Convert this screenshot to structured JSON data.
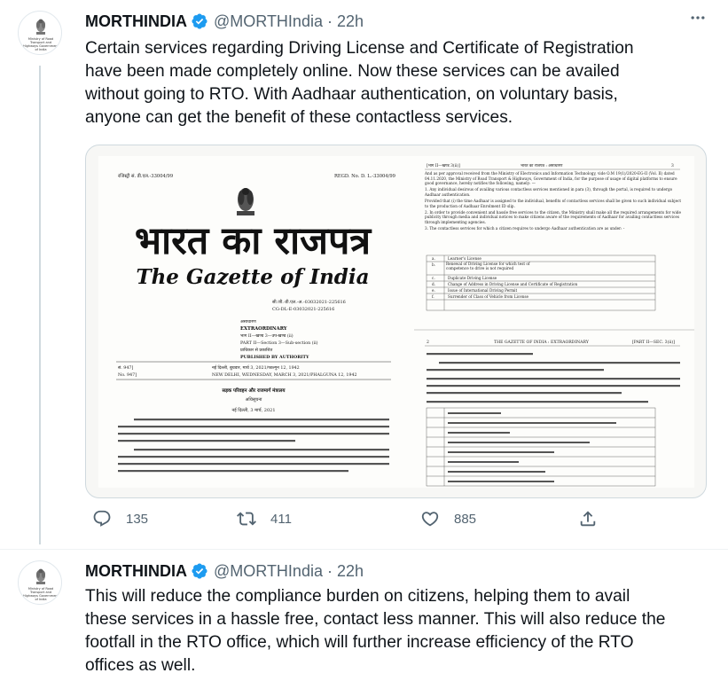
{
  "tweets": [
    {
      "name": "MORTHINDIA",
      "handle": "@MORTHIndia",
      "separator": "·",
      "time": "22h",
      "avatar_caption": "Ministry of Road Transport and Highways Government of India",
      "text_lines": [
        "Certain services regarding Driving License and Certificate of Registration",
        "have been made completely online. Now these services can be availed",
        "without going to RTO. With Aadhaar authentication, on voluntary basis,",
        "anyone can get the benefit of these contactless services."
      ],
      "stats": {
        "replies": "135",
        "retweets": "411",
        "likes": "885"
      }
    },
    {
      "name": "MORTHINDIA",
      "handle": "@MORTHIndia",
      "separator": "·",
      "time": "22h",
      "avatar_caption": "Ministry of Road Transport and Highways Government of India",
      "text_lines": [
        "This will reduce the compliance burden on citizens, helping them to avail",
        "these services in a hassle free, contact less manner. This will also reduce the",
        "footfall in the RTO office, which will further increase efficiency of the RTO",
        "offices as well."
      ]
    }
  ],
  "gazette": {
    "reg_left": "रजिस्ट्री सं. डी.एल.-33004/99",
    "reg_right": "REGD. No. D. L.-33004/99",
    "title_hindi": "भारत का राजपत्र",
    "title_english": "The Gazette of India",
    "cg_hindi": "सी.जी.-डी.एल.-अ.-03032021-225616",
    "cg_english": "CG-DL-E-03032021-225616",
    "extra_hindi": "असाधारण",
    "extra_english": "EXTRAORDINARY",
    "part_hindi": "भाग II—खण्ड 3—उप-खण्ड (ii)",
    "part_english": "PART II—Section 3—Sub-section (ii)",
    "auth_hindi": "प्राधिकार से प्रकाशित",
    "auth_english": "PUBLISHED BY AUTHORITY",
    "no_hindi": "सं. 947]",
    "no_english": "No. 947]",
    "date_hindi": "नई दिल्ली, बुधवार, मार्च 3, 2021/फाल्गुन 12, 1942",
    "date_english": "NEW DELHI, WEDNESDAY, MARCH 3, 2021/PHALGUNA 12, 1942",
    "ministry_hindi": "सड़क परिवहन और राजमार्ग मंत्रालय",
    "notif_hindi": "अधिसूचना",
    "place_date_hindi": "नई दिल्ली, 3 मार्च, 2021",
    "right_head_left": "[भाग II—खण्ड 3(ii)]",
    "right_head_mid": "भारत का राजपत्र : असाधारण",
    "right_head_page": "3",
    "right_para1": "And as per approval received from the Ministry of Electronics and Information Technology, vide O.M 19(1)/2020-EG-II (Vol. II) dated 04.11.2020, the Ministry of Road Transport & Highways, Government of India, for the purpose of usage of digital platforms to ensure good governance, hereby notifies the following, namely: —",
    "right_para2": "1.   Any individual desirous of availing various contactless services mentioned in para (3), through the portal, is required to undergo Aadhaar authentication.",
    "right_para3": "Provided that (i) the time Aadhaar is assigned to the individual, benefits of contactless services shall be given to such individual subject to the production of Aadhaar Enrolment ID slip.",
    "right_para4": "2.   In order to provide convenient and hassle free services to the citizen, the Ministry shall make all the required arrangements for wide publicity through media and individual notices to make citizens aware of the requirements of Aadhaar for availing contactless services through implementing agencies.",
    "right_para5": "3.   The contactless services for which a citizen requires to undergo Aadhaar authentication are as under: -",
    "services_en": [
      {
        "num": "a.",
        "text": "Learner's License"
      },
      {
        "num": "b.",
        "text": "Renewal of Driving License for which test of competence to drive is not required"
      },
      {
        "num": "c.",
        "text": "Duplicate Driving License"
      },
      {
        "num": "d.",
        "text": "Change of Address in Driving License and Certificate of Registration"
      },
      {
        "num": "e.",
        "text": "Issue of International Driving Permit"
      },
      {
        "num": "f.",
        "text": "Surrender of Class of Vehicle from License"
      }
    ],
    "lower_num": "2",
    "lower_mid": "THE GAZETTE OF INDIA : EXTRAORDINARY",
    "lower_right": "[PART II—SEC. 3(ii)]"
  },
  "colors": {
    "text": "#0f1419",
    "secondary": "#536471",
    "verified": "#1d9bf0",
    "border": "#cfd9de"
  },
  "icons": [
    "emblem-icon",
    "verified-badge-icon",
    "more-icon",
    "reply-icon",
    "retweet-icon",
    "like-icon",
    "share-icon"
  ]
}
